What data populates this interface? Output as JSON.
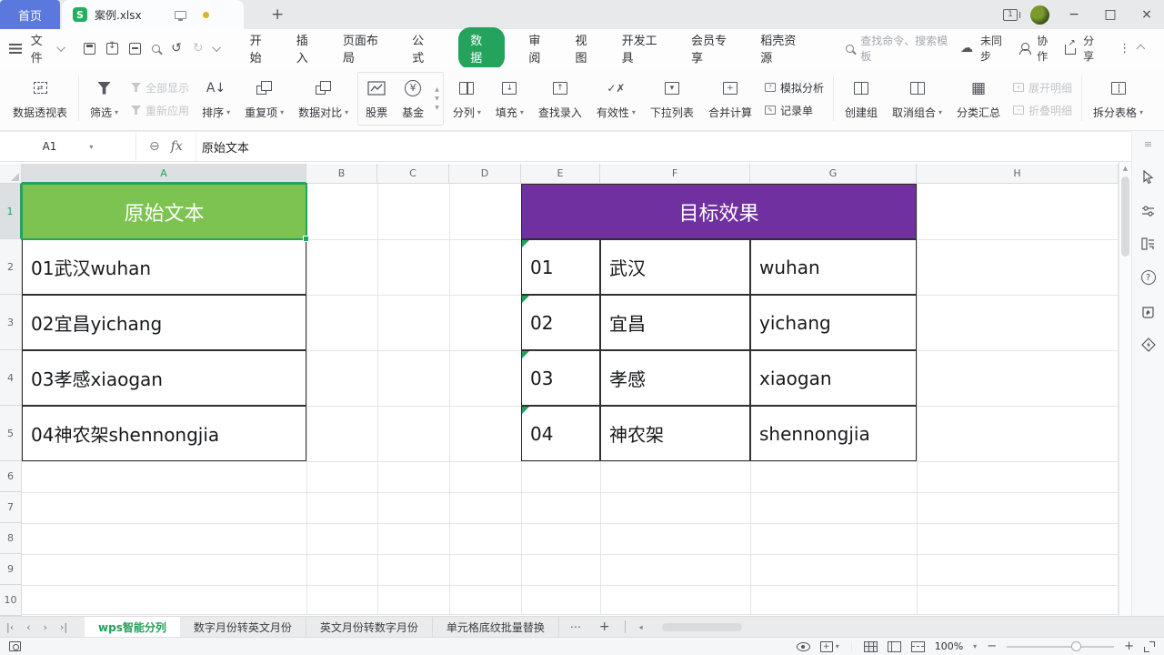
{
  "titlebar": {
    "home_tab": "首页",
    "doc_tab_title": "案例.xlsx",
    "window_count_badge": "1"
  },
  "menubar": {
    "file_menu": "文件",
    "tabs": [
      "开始",
      "插入",
      "页面布局",
      "公式",
      "数据",
      "审阅",
      "视图",
      "开发工具",
      "会员专享",
      "稻壳资源"
    ],
    "active_tab": "数据",
    "search_placeholder": "查找命令、搜索模板",
    "sync_status": "未同步",
    "collaborate": "协作",
    "share": "分享"
  },
  "ribbon": {
    "pivot_table": "数据透视表",
    "filter": "筛选",
    "show_all": "全部显示",
    "reapply": "重新应用",
    "sort": "排序",
    "duplicates": "重复项",
    "data_compare": "数据对比",
    "stock": "股票",
    "fund": "基金",
    "text_to_columns": "分列",
    "fill": "填充",
    "lookup_entry": "查找录入",
    "validation": "有效性",
    "dropdown_list": "下拉列表",
    "consolidate": "合并计算",
    "what_if_analysis": "模拟分析",
    "record_form": "记录单",
    "create_group": "创建组",
    "ungroup": "取消组合",
    "subtotal": "分类汇总",
    "expand_detail": "展开明细",
    "collapse_detail": "折叠明细",
    "split_sheet": "拆分表格"
  },
  "formula_bar": {
    "name_box": "A1",
    "fx_label": "fx",
    "content": "原始文本"
  },
  "sheet": {
    "col_headers": [
      "A",
      "B",
      "C",
      "D",
      "E",
      "F",
      "G",
      "H"
    ],
    "row_headers": [
      "1",
      "2",
      "3",
      "4",
      "5",
      "6",
      "7",
      "8",
      "9",
      "10"
    ],
    "left_table": {
      "header": "原始文本",
      "header_bg": "#7cc351",
      "rows": [
        "01武汉wuhan",
        "02宜昌yichang",
        "03孝感xiaogan",
        "04神农架shennongjia"
      ]
    },
    "right_table": {
      "header": "目标效果",
      "header_bg": "#7030a0",
      "rows": [
        {
          "code": "01",
          "city": "武汉",
          "pinyin": "wuhan"
        },
        {
          "code": "02",
          "city": "宜昌",
          "pinyin": "yichang"
        },
        {
          "code": "03",
          "city": "孝感",
          "pinyin": "xiaogan"
        },
        {
          "code": "04",
          "city": "神农架",
          "pinyin": "shennongjia"
        }
      ]
    }
  },
  "sheet_tabs": {
    "tabs": [
      "wps智能分列",
      "数字月份转英文月份",
      "英文月份转数字月份",
      "单元格底纹批量替换"
    ],
    "active": "wps智能分列"
  },
  "status_bar": {
    "zoom_level": "100%"
  }
}
